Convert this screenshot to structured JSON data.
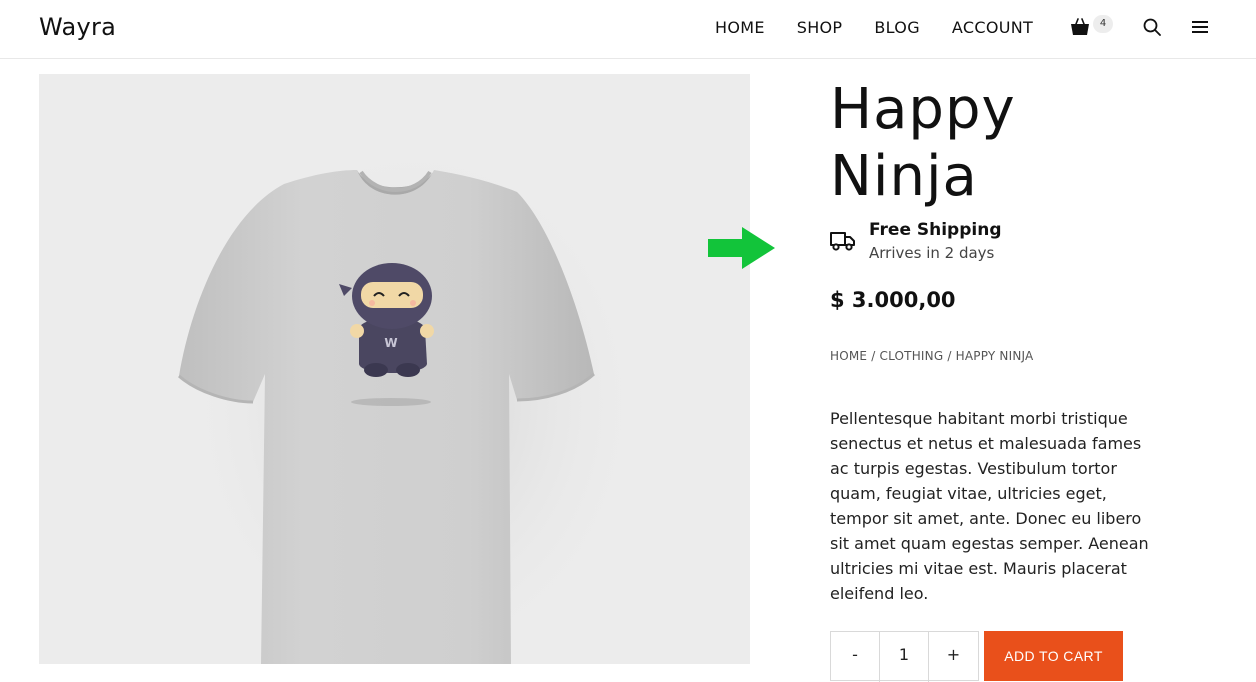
{
  "site": {
    "logo": "Wayra"
  },
  "nav": {
    "items": [
      {
        "label": "HOME"
      },
      {
        "label": "SHOP"
      },
      {
        "label": "BLOG"
      },
      {
        "label": "ACCOUNT"
      }
    ],
    "cart_count": "4"
  },
  "product": {
    "title_line1": "Happy",
    "title_line2": "Ninja",
    "shipping_title": "Free Shipping",
    "shipping_sub": "Arrives in 2 days",
    "price": "$ 3.000,00",
    "breadcrumb": [
      "HOME",
      "CLOTHING",
      "HAPPY NINJA"
    ],
    "breadcrumb_sep": " / ",
    "description": "Pellentesque habitant morbi tristique senectus et netus et malesuada fames ac turpis egestas. Vestibulum tortor quam, feugiat vitae, ultricies eget, tempor sit amet, ante. Donec eu libero sit amet quam egestas semper. Aenean ultricies mi vitae est. Mauris placerat eleifend leo.",
    "image_logo_letter": "W",
    "quantity": {
      "minus": "-",
      "value": "1",
      "plus": "+"
    },
    "add_to_cart": "ADD TO CART"
  },
  "colors": {
    "accent": "#e9501b",
    "arrow": "#1db954",
    "image_bg": "#ececec"
  },
  "icons": {
    "cart": "shopping-basket-icon",
    "search": "search-icon",
    "menu": "hamburger-menu-icon",
    "shipping": "delivery-truck-icon",
    "annotation": "green-arrow-icon"
  }
}
